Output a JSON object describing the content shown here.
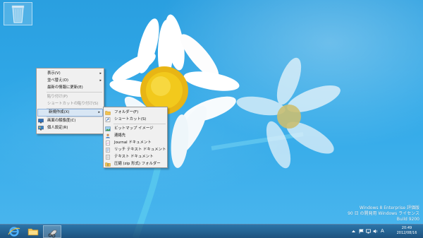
{
  "desktop": {
    "recycle_bin_icon": "recycle-bin-icon"
  },
  "context_menu": {
    "items": [
      {
        "label": "表示(V)",
        "has_submenu": true,
        "disabled": false
      },
      {
        "label": "並べ替え(O)",
        "has_submenu": true,
        "disabled": false
      },
      {
        "label": "最新の情報に更新(E)",
        "has_submenu": false,
        "disabled": false
      },
      {
        "label": "貼り付け(P)",
        "has_submenu": false,
        "disabled": true
      },
      {
        "label": "ショートカットの貼り付け(S)",
        "has_submenu": false,
        "disabled": true
      },
      {
        "label": "新規作成(X)",
        "has_submenu": true,
        "disabled": false,
        "highlighted": true
      },
      {
        "label": "画面の解像度(C)",
        "has_submenu": false,
        "disabled": false,
        "icon": "display-icon"
      },
      {
        "label": "個人設定(R)",
        "has_submenu": false,
        "disabled": false,
        "icon": "personalize-icon"
      }
    ]
  },
  "new_submenu": {
    "items": [
      {
        "label": "フォルダー(F)",
        "icon": "folder-icon"
      },
      {
        "label": "ショートカット(S)",
        "icon": "shortcut-icon"
      },
      {
        "label": "ビットマップ イメージ",
        "icon": "bitmap-icon"
      },
      {
        "label": "連絡先",
        "icon": "contact-icon"
      },
      {
        "label": "Journal ドキュメント",
        "icon": "journal-icon"
      },
      {
        "label": "リッチ テキスト ドキュメント",
        "icon": "rich-text-icon"
      },
      {
        "label": "テキスト ドキュメント",
        "icon": "text-document-icon"
      },
      {
        "label": "圧縮 (zip 形式) フォルダー",
        "icon": "zip-folder-icon"
      }
    ]
  },
  "watermark": {
    "line1": "Windows 8 Enterprise 評価版",
    "line2": "90 日 の開発用 Windows ライセンス",
    "line3": "Build 9200"
  },
  "taskbar": {
    "buttons": [
      "internet-explorer-icon",
      "file-explorer-icon",
      "snipping-tool-icon"
    ],
    "clock_time": "20:49",
    "clock_date": "2012/08/16",
    "ime": "A"
  },
  "colors": {
    "sky": "#31a9e8",
    "menu_bg": "#f0f0f0",
    "menu_highlight": "#d8e6f4",
    "taskbar": "#1a4a7c"
  }
}
